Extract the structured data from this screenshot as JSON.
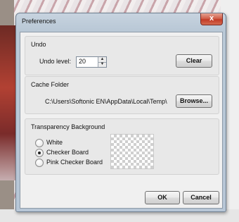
{
  "window": {
    "title": "Preferences",
    "close_label": "x"
  },
  "undo": {
    "title": "Undo",
    "level_label": "Undo level:",
    "level_value": "20",
    "clear_label": "Clear"
  },
  "cache": {
    "title": "Cache Folder",
    "path": "C:\\Users\\Softonic EN\\AppData\\Local\\Temp\\",
    "browse_label": "Browse..."
  },
  "transparency": {
    "title": "Transparency Background",
    "options": [
      {
        "label": "White",
        "selected": false
      },
      {
        "label": "Checker Board",
        "selected": true
      },
      {
        "label": "Pink Checker Board",
        "selected": false
      }
    ]
  },
  "footer": {
    "ok_label": "OK",
    "cancel_label": "Cancel"
  }
}
